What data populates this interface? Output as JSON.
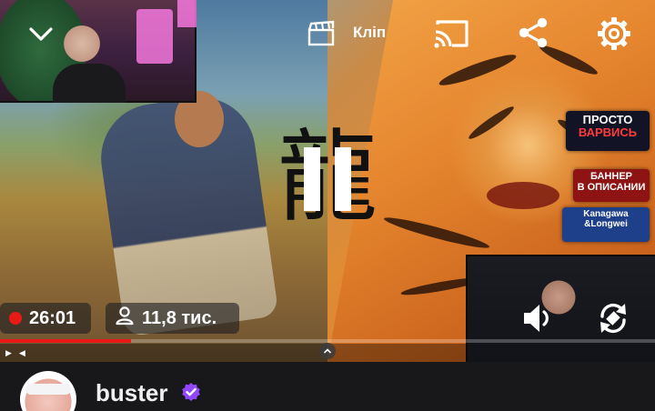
{
  "player": {
    "clip_label": "Кліп",
    "live_time": "26:01",
    "viewers": "11,8 тис.",
    "progress_fraction": 0.2
  },
  "channel": {
    "name": "buster",
    "verified": true
  },
  "ads": {
    "tile1_line1": "ПРОСТО",
    "tile1_line2": "ВАРВИСЬ",
    "tile2_line1": "БАННЕР",
    "tile2_line2": "В ОПИСАНИИ",
    "tile3_line1": "Kanagawa",
    "tile3_line2": "&Longwei"
  },
  "colors": {
    "live_red": "#e91916",
    "verified_purple": "#9147ff",
    "bar_bg": "#18181b"
  },
  "icons": [
    "chevron-down-icon",
    "clip-icon",
    "cast-icon",
    "share-icon",
    "settings-icon",
    "pause-icon",
    "viewer-icon",
    "volume-icon",
    "rotate-icon",
    "verified-icon"
  ]
}
